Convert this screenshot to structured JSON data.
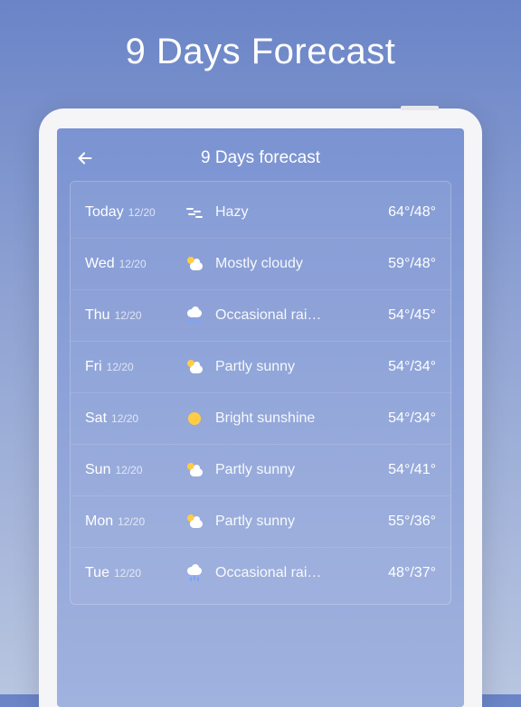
{
  "promo": {
    "title": "9 Days Forecast"
  },
  "header": {
    "title": "9  Days forecast"
  },
  "forecast": [
    {
      "day": "Today",
      "date": "12/20",
      "icon": "haze",
      "cond": "Hazy",
      "hi": "64°",
      "lo": "48°"
    },
    {
      "day": "Wed",
      "date": "12/20",
      "icon": "partly",
      "cond": "Mostly cloudy",
      "hi": "59°",
      "lo": "48°"
    },
    {
      "day": "Thu",
      "date": "12/20",
      "icon": "rain",
      "cond": "Occasional rai…",
      "hi": "54°",
      "lo": "45°"
    },
    {
      "day": "Fri",
      "date": "12/20",
      "icon": "partly",
      "cond": "Partly sunny",
      "hi": "54°",
      "lo": "34°"
    },
    {
      "day": "Sat",
      "date": "12/20",
      "icon": "sun",
      "cond": "Bright sunshine",
      "hi": "54°",
      "lo": "34°"
    },
    {
      "day": "Sun",
      "date": "12/20",
      "icon": "partly",
      "cond": "Partly sunny",
      "hi": "54°",
      "lo": "41°"
    },
    {
      "day": "Mon",
      "date": "12/20",
      "icon": "partly",
      "cond": "Partly sunny",
      "hi": "55°",
      "lo": "36°"
    },
    {
      "day": "Tue",
      "date": "12/20",
      "icon": "rain",
      "cond": "Occasional rai…",
      "hi": "48°",
      "lo": "37°"
    }
  ]
}
